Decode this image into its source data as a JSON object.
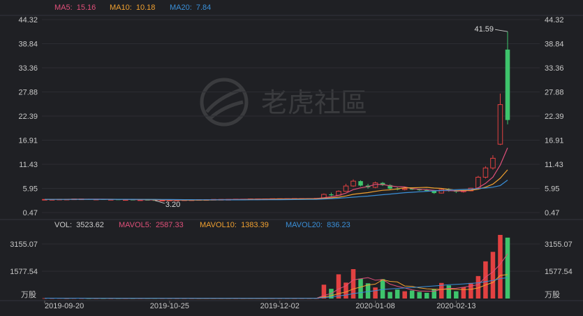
{
  "chart_data": {
    "type": "candlestick",
    "watermark": "老虎社區",
    "price_panel": {
      "ylim": [
        0.47,
        44.32
      ],
      "ticks": [
        "44.32",
        "38.84",
        "33.36",
        "27.88",
        "22.39",
        "16.91",
        "11.43",
        "5.95",
        "0.47"
      ],
      "legend": [
        {
          "label": "MA5:",
          "value": "15.16",
          "color": "#e0507a"
        },
        {
          "label": "MA10:",
          "value": "10.18",
          "color": "#f0a030"
        },
        {
          "label": "MA20:",
          "value": "7.84",
          "color": "#3a8fd8"
        }
      ],
      "high_annotation": "41.59",
      "low_annotation": "3.20",
      "series": [
        {
          "o": 3.4,
          "h": 3.5,
          "l": 3.4,
          "c": 3.45
        },
        {
          "o": 3.45,
          "h": 3.5,
          "l": 3.4,
          "c": 3.45
        },
        {
          "o": 3.45,
          "h": 3.55,
          "l": 3.45,
          "c": 3.5
        },
        {
          "o": 3.5,
          "h": 3.55,
          "l": 3.45,
          "c": 3.5
        },
        {
          "o": 3.5,
          "h": 3.6,
          "l": 3.5,
          "c": 3.55
        },
        {
          "o": 3.55,
          "h": 3.6,
          "l": 3.5,
          "c": 3.55
        },
        {
          "o": 3.55,
          "h": 3.6,
          "l": 3.5,
          "c": 3.5
        },
        {
          "o": 3.5,
          "h": 3.55,
          "l": 3.45,
          "c": 3.5
        },
        {
          "o": 3.5,
          "h": 3.55,
          "l": 3.45,
          "c": 3.45
        },
        {
          "o": 3.45,
          "h": 3.5,
          "l": 3.4,
          "c": 3.45
        },
        {
          "o": 3.45,
          "h": 3.5,
          "l": 3.4,
          "c": 3.4
        },
        {
          "o": 3.4,
          "h": 3.45,
          "l": 3.35,
          "c": 3.4
        },
        {
          "o": 3.4,
          "h": 3.45,
          "l": 3.35,
          "c": 3.35
        },
        {
          "o": 3.35,
          "h": 3.4,
          "l": 3.3,
          "c": 3.35
        },
        {
          "o": 3.35,
          "h": 3.4,
          "l": 3.25,
          "c": 3.3
        },
        {
          "o": 3.3,
          "h": 3.35,
          "l": 3.2,
          "c": 3.25
        },
        {
          "o": 3.25,
          "h": 3.3,
          "l": 3.2,
          "c": 3.25
        },
        {
          "o": 3.25,
          "h": 3.3,
          "l": 3.2,
          "c": 3.3
        },
        {
          "o": 3.3,
          "h": 3.35,
          "l": 3.25,
          "c": 3.3
        },
        {
          "o": 3.3,
          "h": 3.4,
          "l": 3.3,
          "c": 3.35
        },
        {
          "o": 3.35,
          "h": 3.4,
          "l": 3.3,
          "c": 3.35
        },
        {
          "o": 3.35,
          "h": 3.45,
          "l": 3.35,
          "c": 3.4
        },
        {
          "o": 3.4,
          "h": 3.45,
          "l": 3.35,
          "c": 3.4
        },
        {
          "o": 3.4,
          "h": 3.5,
          "l": 3.4,
          "c": 3.45
        },
        {
          "o": 3.45,
          "h": 3.5,
          "l": 3.4,
          "c": 3.45
        },
        {
          "o": 3.45,
          "h": 3.5,
          "l": 3.4,
          "c": 3.45
        },
        {
          "o": 3.45,
          "h": 3.55,
          "l": 3.45,
          "c": 3.5
        },
        {
          "o": 3.5,
          "h": 3.55,
          "l": 3.45,
          "c": 3.5
        },
        {
          "o": 3.5,
          "h": 3.6,
          "l": 3.45,
          "c": 3.55
        },
        {
          "o": 3.55,
          "h": 3.6,
          "l": 3.5,
          "c": 3.55
        },
        {
          "o": 3.55,
          "h": 3.6,
          "l": 3.5,
          "c": 3.55
        },
        {
          "o": 3.55,
          "h": 3.6,
          "l": 3.5,
          "c": 3.6
        },
        {
          "o": 3.6,
          "h": 3.65,
          "l": 3.55,
          "c": 3.6
        },
        {
          "o": 3.6,
          "h": 3.65,
          "l": 3.55,
          "c": 3.6
        },
        {
          "o": 3.6,
          "h": 3.65,
          "l": 3.55,
          "c": 3.65
        },
        {
          "o": 3.65,
          "h": 3.7,
          "l": 3.6,
          "c": 3.65
        },
        {
          "o": 3.65,
          "h": 3.7,
          "l": 3.6,
          "c": 3.65
        },
        {
          "o": 3.65,
          "h": 3.7,
          "l": 3.6,
          "c": 3.7
        },
        {
          "o": 3.6,
          "h": 4.8,
          "l": 3.6,
          "c": 4.6
        },
        {
          "o": 4.6,
          "h": 5.0,
          "l": 4.2,
          "c": 4.4
        },
        {
          "o": 4.4,
          "h": 5.5,
          "l": 4.3,
          "c": 5.3
        },
        {
          "o": 5.3,
          "h": 7.0,
          "l": 5.2,
          "c": 6.5
        },
        {
          "o": 6.5,
          "h": 8.0,
          "l": 6.3,
          "c": 7.6
        },
        {
          "o": 7.6,
          "h": 7.8,
          "l": 6.4,
          "c": 6.6
        },
        {
          "o": 6.6,
          "h": 7.0,
          "l": 5.9,
          "c": 6.2
        },
        {
          "o": 6.2,
          "h": 7.5,
          "l": 6.0,
          "c": 7.2
        },
        {
          "o": 7.2,
          "h": 7.4,
          "l": 6.5,
          "c": 6.7
        },
        {
          "o": 6.7,
          "h": 6.9,
          "l": 5.7,
          "c": 5.9
        },
        {
          "o": 5.9,
          "h": 6.2,
          "l": 5.5,
          "c": 5.7
        },
        {
          "o": 5.7,
          "h": 6.1,
          "l": 5.5,
          "c": 5.9
        },
        {
          "o": 5.9,
          "h": 6.1,
          "l": 5.6,
          "c": 5.7
        },
        {
          "o": 5.7,
          "h": 5.9,
          "l": 5.4,
          "c": 5.6
        },
        {
          "o": 5.6,
          "h": 5.8,
          "l": 5.3,
          "c": 5.4
        },
        {
          "o": 5.4,
          "h": 5.6,
          "l": 4.7,
          "c": 4.9
        },
        {
          "o": 4.9,
          "h": 5.9,
          "l": 4.8,
          "c": 5.7
        },
        {
          "o": 5.7,
          "h": 6.0,
          "l": 5.2,
          "c": 5.4
        },
        {
          "o": 5.4,
          "h": 5.5,
          "l": 4.9,
          "c": 5.2
        },
        {
          "o": 5.2,
          "h": 5.6,
          "l": 5.0,
          "c": 5.4
        },
        {
          "o": 5.4,
          "h": 6.1,
          "l": 5.3,
          "c": 6.0
        },
        {
          "o": 6.0,
          "h": 8.8,
          "l": 5.9,
          "c": 8.5
        },
        {
          "o": 8.5,
          "h": 11.0,
          "l": 8.2,
          "c": 10.6
        },
        {
          "o": 10.6,
          "h": 13.5,
          "l": 10.2,
          "c": 12.8
        },
        {
          "o": 16.0,
          "h": 27.5,
          "l": 15.8,
          "c": 25.0
        },
        {
          "o": 37.5,
          "h": 41.59,
          "l": 20.5,
          "c": 21.5
        }
      ],
      "ma5": [
        3.45,
        3.46,
        3.47,
        3.48,
        3.5,
        3.51,
        3.52,
        3.51,
        3.5,
        3.48,
        3.46,
        3.44,
        3.41,
        3.39,
        3.36,
        3.33,
        3.3,
        3.29,
        3.28,
        3.29,
        3.31,
        3.33,
        3.36,
        3.39,
        3.41,
        3.43,
        3.45,
        3.47,
        3.49,
        3.51,
        3.53,
        3.55,
        3.57,
        3.58,
        3.6,
        3.62,
        3.63,
        3.65,
        3.84,
        4.04,
        4.37,
        4.88,
        5.68,
        6.08,
        6.38,
        6.86,
        6.88,
        6.52,
        6.34,
        6.28,
        5.9,
        5.76,
        5.66,
        5.5,
        5.46,
        5.46,
        5.36,
        5.34,
        5.54,
        6.1,
        7.1,
        8.52,
        11.28,
        15.16
      ],
      "ma10": [
        3.45,
        3.45,
        3.46,
        3.46,
        3.47,
        3.48,
        3.48,
        3.48,
        3.48,
        3.49,
        3.48,
        3.47,
        3.46,
        3.44,
        3.43,
        3.41,
        3.39,
        3.36,
        3.34,
        3.32,
        3.31,
        3.31,
        3.32,
        3.33,
        3.34,
        3.36,
        3.38,
        3.4,
        3.42,
        3.44,
        3.46,
        3.48,
        3.5,
        3.52,
        3.53,
        3.55,
        3.57,
        3.59,
        3.69,
        3.8,
        3.97,
        4.23,
        4.62,
        4.82,
        5.0,
        5.28,
        5.52,
        5.63,
        5.84,
        6.1,
        6.09,
        6.14,
        6.19,
        6.03,
        5.95,
        5.73,
        5.56,
        5.5,
        5.52,
        5.78,
        6.23,
        6.94,
        8.27,
        10.18
      ],
      "ma20": [
        3.45,
        3.45,
        3.45,
        3.46,
        3.46,
        3.46,
        3.47,
        3.47,
        3.47,
        3.47,
        3.47,
        3.47,
        3.47,
        3.46,
        3.46,
        3.45,
        3.44,
        3.42,
        3.41,
        3.4,
        3.39,
        3.38,
        3.37,
        3.36,
        3.36,
        3.35,
        3.35,
        3.35,
        3.36,
        3.36,
        3.37,
        3.38,
        3.39,
        3.41,
        3.42,
        3.44,
        3.46,
        3.48,
        3.55,
        3.63,
        3.72,
        3.84,
        3.97,
        4.09,
        4.21,
        4.36,
        4.52,
        4.66,
        4.82,
        4.98,
        5.08,
        5.19,
        5.3,
        5.39,
        5.48,
        5.57,
        5.64,
        5.7,
        5.77,
        5.92,
        6.05,
        6.23,
        6.6,
        7.84
      ]
    },
    "volume_panel": {
      "unit": "万股",
      "ylim": [
        0,
        3600
      ],
      "ticks": [
        "3155.07",
        "1577.54"
      ],
      "legend": [
        {
          "label": "VOL:",
          "value": "3523.62",
          "color": "#cccccc"
        },
        {
          "label": "MAVOL5:",
          "value": "2587.33",
          "color": "#e0507a"
        },
        {
          "label": "MAVOL10:",
          "value": "1383.39",
          "color": "#f0a030"
        },
        {
          "label": "MAVOL20:",
          "value": "836.23",
          "color": "#3a8fd8"
        }
      ],
      "values": [
        20,
        18,
        22,
        15,
        20,
        18,
        16,
        14,
        15,
        12,
        14,
        13,
        12,
        15,
        18,
        22,
        16,
        14,
        12,
        15,
        14,
        13,
        16,
        15,
        14,
        15,
        13,
        14,
        16,
        15,
        14,
        15,
        14,
        16,
        15,
        16,
        14,
        15,
        800,
        560,
        1400,
        920,
        1700,
        1150,
        880,
        640,
        1120,
        380,
        520,
        420,
        460,
        380,
        330,
        550,
        900,
        760,
        420,
        650,
        900,
        1300,
        2150,
        2700,
        4000,
        3523.62
      ],
      "mavol5": [
        20,
        19,
        19,
        18,
        19,
        19,
        18,
        17,
        17,
        15,
        14,
        14,
        13,
        13,
        14,
        15,
        16,
        17,
        16,
        15,
        15,
        14,
        14,
        15,
        14,
        14,
        15,
        14,
        14,
        14,
        14,
        15,
        15,
        15,
        15,
        15,
        15,
        15,
        179,
        289,
        556,
        738,
        1076,
        1146,
        1210,
        1058,
        1098,
        834,
        708,
        612,
        500,
        432,
        424,
        426,
        528,
        584,
        592,
        652,
        726,
        802,
        1236,
        1540,
        1990,
        2587
      ],
      "mavol10": [
        20,
        19,
        19,
        18,
        19,
        19,
        18,
        17,
        17,
        17,
        17,
        17,
        16,
        16,
        17,
        17,
        16,
        16,
        15,
        15,
        15,
        14,
        14,
        14,
        14,
        14,
        15,
        14,
        14,
        14,
        14,
        15,
        15,
        15,
        15,
        15,
        15,
        15,
        97,
        153,
        286,
        378,
        553,
        662,
        783,
        835,
        1087,
        990,
        959,
        725,
        704,
        616,
        562,
        540,
        525,
        547,
        532,
        516,
        529,
        610,
        785,
        932,
        1339,
        1383
      ],
      "mavol20": [
        20,
        19,
        19,
        18,
        19,
        19,
        18,
        17,
        17,
        17,
        17,
        17,
        16,
        16,
        17,
        17,
        16,
        16,
        15,
        15,
        15,
        15,
        15,
        15,
        15,
        15,
        15,
        15,
        15,
        15,
        15,
        15,
        15,
        15,
        15,
        15,
        15,
        15,
        56,
        84,
        154,
        200,
        288,
        341,
        400,
        452,
        526,
        554,
        583,
        612,
        637,
        665,
        694,
        728,
        760,
        796,
        817,
        844,
        872,
        905,
        975,
        1047,
        1153,
        1200
      ]
    },
    "x_dates": [
      "2019-09-20",
      "2019-10-25",
      "2019-12-02",
      "2020-01-08",
      "2020-02-13"
    ],
    "colors": {
      "up": "#e24141",
      "down": "#3ec46c",
      "grid": "#2c2d32",
      "axis_text": "#c8c8c8",
      "bg": "#1f2024"
    }
  }
}
